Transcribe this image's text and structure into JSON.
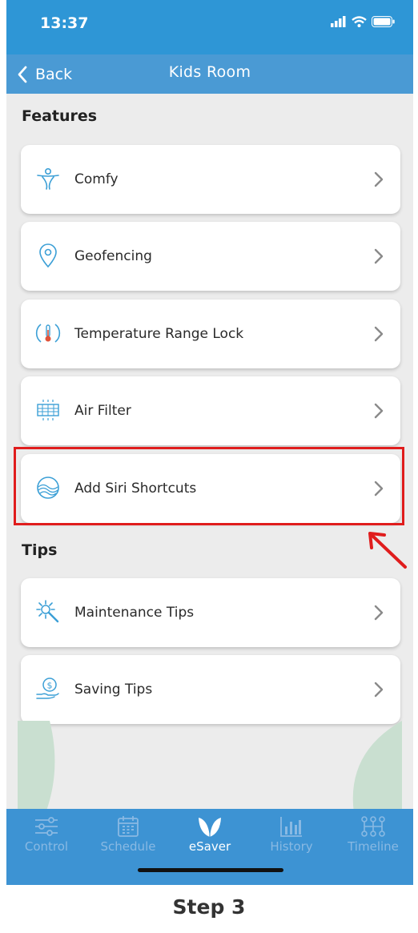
{
  "status": {
    "time": "13:37"
  },
  "nav": {
    "back_label": "Back",
    "title": "Kids Room"
  },
  "features": {
    "title": "Features",
    "items": [
      {
        "label": "Comfy",
        "icon": "comfy-person-icon"
      },
      {
        "label": "Geofencing",
        "icon": "location-pin-icon"
      },
      {
        "label": "Temperature Range Lock",
        "icon": "thermometer-lock-icon"
      },
      {
        "label": "Air Filter",
        "icon": "air-filter-icon"
      },
      {
        "label": "Add Siri Shortcuts",
        "icon": "siri-icon"
      }
    ]
  },
  "tips": {
    "title": "Tips",
    "items": [
      {
        "label": "Maintenance Tips",
        "icon": "maintenance-gear-icon"
      },
      {
        "label": "Saving Tips",
        "icon": "saving-money-hand-icon"
      }
    ]
  },
  "tabs": [
    {
      "label": "Control",
      "icon": "sliders-icon"
    },
    {
      "label": "Schedule",
      "icon": "calendar-icon"
    },
    {
      "label": "eSaver",
      "icon": "leaf-icon",
      "active": true
    },
    {
      "label": "History",
      "icon": "bar-chart-icon"
    },
    {
      "label": "Timeline",
      "icon": "timeline-icon"
    }
  ],
  "caption": "Step 3",
  "colors": {
    "accent": "#2e96d6",
    "nav": "#4a9ad4",
    "tabbar": "#3d93d3",
    "icon": "#3b9fd6",
    "highlight": "#e01d1d"
  }
}
